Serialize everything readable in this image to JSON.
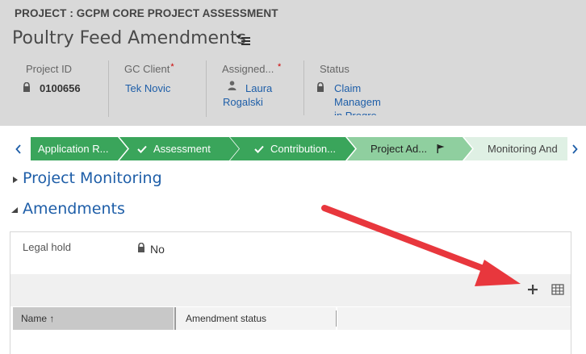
{
  "header": {
    "form_type": "PROJECT : GCPM CORE PROJECT ASSESSMENT",
    "title": "Poultry Feed Amendments",
    "fields": [
      {
        "label": "Project ID",
        "value": "0100656",
        "required": false,
        "locked": true
      },
      {
        "label": "GC Client",
        "value": "Tek Novic",
        "required": true,
        "locked": false
      },
      {
        "label": "Assigned...",
        "value_line1": "Laura",
        "value_line2": "Rogalski",
        "required": true,
        "locked": false
      },
      {
        "label": "Status",
        "value_line1": "Claim",
        "value_line2": "Managem",
        "value_line3": "in Progre",
        "required": false,
        "locked": true
      }
    ],
    "required_mark": "*"
  },
  "process": {
    "stages": [
      {
        "label": "Application R...",
        "state": "completed"
      },
      {
        "label": "Assessment",
        "state": "completed"
      },
      {
        "label": "Contribution...",
        "state": "completed"
      },
      {
        "label": "Project Ad...",
        "state": "active"
      },
      {
        "label": "Monitoring And",
        "state": "upcoming"
      }
    ]
  },
  "sections": {
    "monitoring": {
      "title": "Project Monitoring",
      "expanded": false
    },
    "amendments": {
      "title": "Amendments",
      "expanded": true
    }
  },
  "amendments": {
    "legal_hold_label": "Legal hold",
    "legal_hold_value": "No",
    "grid": {
      "columns": [
        "Name ↑",
        "Amendment status"
      ]
    }
  },
  "colors": {
    "header_bg": "#d9d9d9",
    "stage_completed": "#3aa55b",
    "stage_active": "#8fcf9f",
    "stage_upcoming": "#dff0e4",
    "link": "#1e5ea8",
    "annotation_arrow": "#e8373d"
  }
}
